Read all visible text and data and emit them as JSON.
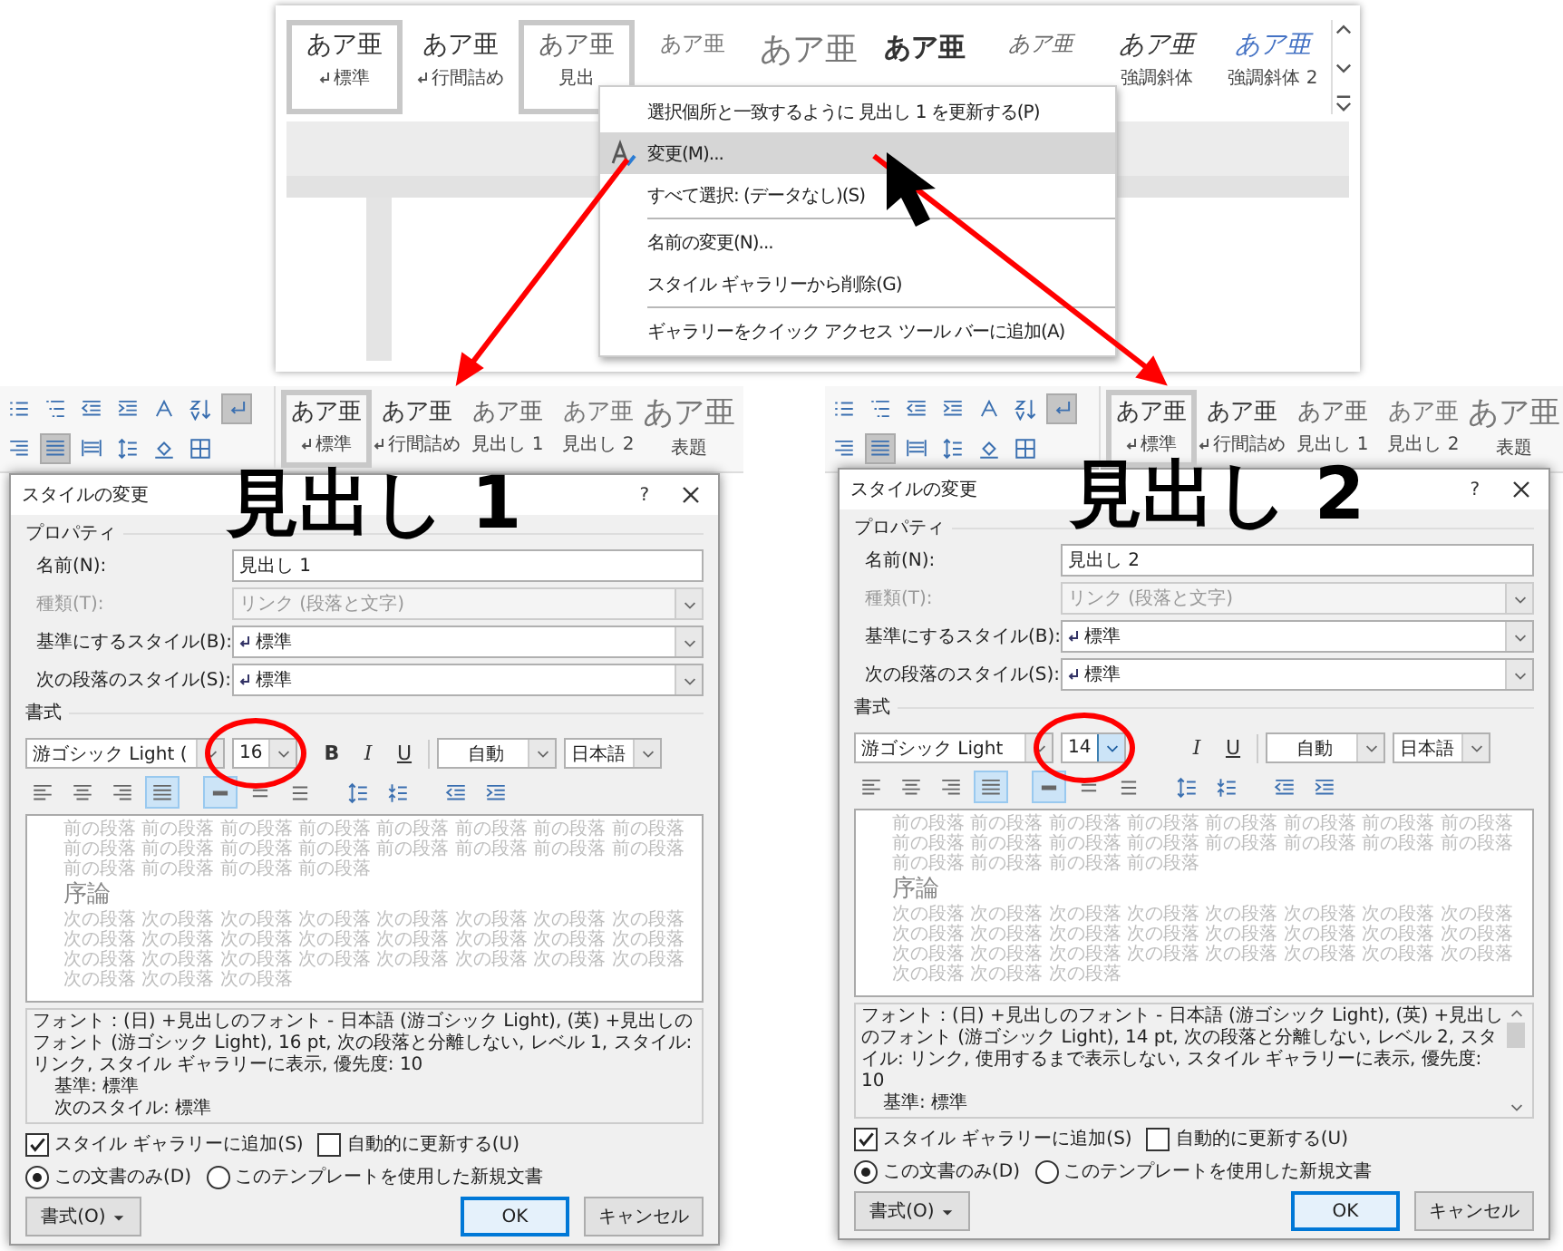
{
  "top_window": {
    "gallery": [
      {
        "sample": "あア亜",
        "label": "標準",
        "linked": true,
        "selected": true,
        "kind": "normal"
      },
      {
        "sample": "あア亜",
        "label": "行間詰め",
        "linked": true,
        "selected": false,
        "kind": "normal"
      },
      {
        "sample": "あア亜",
        "label": "見出",
        "selected": true,
        "kind": "light"
      },
      {
        "sample": "あア亜",
        "selected": false,
        "kind": "light-small"
      },
      {
        "sample": "あア亜",
        "selected": false,
        "kind": "large"
      },
      {
        "sample": "あア亜",
        "selected": false,
        "kind": "bold"
      },
      {
        "sample": "あア亜",
        "selected": false,
        "kind": "italic-light"
      },
      {
        "sample": "あア亜",
        "label": "強調斜体",
        "selected": false,
        "kind": "italic"
      },
      {
        "sample": "あア亜",
        "label": "強調斜体 2",
        "selected": false,
        "kind": "accent"
      }
    ],
    "context_menu": [
      {
        "text": "選択個所と一致するように 見出し 1 を更新する(P)",
        "highlighted": false,
        "has_icon": false,
        "separator_below": false
      },
      {
        "text": "変更(M)...",
        "highlighted": true,
        "has_icon": true,
        "separator_below": false
      },
      {
        "text": "すべて選択: (データなし)(S)",
        "highlighted": false,
        "has_icon": false,
        "separator_below": true
      },
      {
        "text": "名前の変更(N)...",
        "highlighted": false,
        "has_icon": false,
        "separator_below": false
      },
      {
        "text": "スタイル ギャラリーから削除(G)",
        "highlighted": false,
        "has_icon": false,
        "separator_below": true
      },
      {
        "text": "ギャラリーをクイック アクセス ツール バーに追加(A)",
        "highlighted": false,
        "has_icon": false,
        "separator_below": false
      }
    ]
  },
  "panels": [
    {
      "caption": "見出し 1",
      "ribbon": {
        "row1": [
          {
            "kind": "bullets",
            "selected": false
          },
          {
            "kind": "multilevel",
            "selected": false
          },
          {
            "kind": "indent-decrease",
            "selected": false
          },
          {
            "kind": "indent-increase",
            "selected": false
          },
          {
            "kind": "asian-layout",
            "selected": false
          },
          {
            "kind": "sort",
            "selected": false
          },
          {
            "kind": "show-marks",
            "selected": true
          }
        ],
        "row2": [
          {
            "kind": "align-right",
            "selected": false
          },
          {
            "kind": "justify",
            "selected": true
          },
          {
            "kind": "distributed",
            "selected": false
          },
          {
            "kind": "line-spacing",
            "selected": false
          },
          {
            "kind": "shading",
            "selected": false
          },
          {
            "kind": "borders",
            "selected": false
          }
        ],
        "gallery": [
          {
            "sample": "あア亜",
            "label": "標準",
            "linked": true,
            "selected": true,
            "kind": "normal"
          },
          {
            "sample": "あア亜",
            "label": "行間詰め",
            "linked": true,
            "selected": false,
            "kind": "normal"
          },
          {
            "sample": "あア亜",
            "label": "見出し 1",
            "selected": false,
            "kind": "light"
          },
          {
            "sample": "あア亜",
            "label": "見出し 2",
            "selected": false,
            "kind": "light-small"
          },
          {
            "sample": "あア亜",
            "label": "表題",
            "selected": false,
            "kind": "large"
          }
        ]
      },
      "dialog": {
        "title": "スタイルの変更",
        "help": "?",
        "properties_heading": "プロパティ",
        "fields": [
          {
            "label": "名前(N):",
            "value": "見出し 1",
            "kind": "text",
            "disabled": false
          },
          {
            "label": "種類(T):",
            "value": "リンク (段落と文字)",
            "kind": "select",
            "disabled": true
          },
          {
            "label": "基準にするスタイル(B):",
            "value": "標準",
            "kind": "select",
            "linked": true,
            "disabled": false
          },
          {
            "label": "次の段落のスタイル(S):",
            "value": "標準",
            "kind": "select",
            "linked": true,
            "disabled": false
          }
        ],
        "format_heading": "書式",
        "font": "游ゴシック Light (",
        "size": "16",
        "size_focused": false,
        "format_buttons": [
          {
            "kind": "bold",
            "text": "B"
          },
          {
            "kind": "italic",
            "text": "I"
          },
          {
            "kind": "underline",
            "text": "U"
          }
        ],
        "font_color": "自動",
        "language": "日本語",
        "align_tools": [
          {
            "kind": "align-left",
            "selected": false
          },
          {
            "kind": "align-center",
            "selected": false
          },
          {
            "kind": "align-right",
            "selected": false
          },
          {
            "kind": "justify",
            "selected": true
          },
          {
            "kind": "single",
            "selected": true
          },
          {
            "kind": "one-half",
            "selected": false
          },
          {
            "kind": "double",
            "selected": false
          },
          {
            "kind": "spacing-increase",
            "selected": false
          },
          {
            "kind": "spacing-decrease",
            "selected": false
          },
          {
            "kind": "indent-decrease",
            "selected": false
          },
          {
            "kind": "indent-increase",
            "selected": false
          }
        ],
        "preview": {
          "previous": [
            "前の段落 前の段落 前の段落 前の段落 前の段落 前の段落 前の段落 前の段落",
            "前の段落 前の段落 前の段落 前の段落 前の段落 前の段落 前の段落 前の段落",
            "前の段落 前の段落 前の段落 前の段落"
          ],
          "sample": "序論",
          "next": [
            "次の段落 次の段落 次の段落 次の段落 次の段落 次の段落 次の段落 次の段落",
            "次の段落 次の段落 次の段落 次の段落 次の段落 次の段落 次の段落 次の段落",
            "次の段落 次の段落 次の段落 次の段落 次の段落 次の段落 次の段落 次の段落",
            "次の段落 次の段落 次の段落"
          ]
        },
        "description": [
          "フォント：(日) +見出しのフォント - 日本語 (游ゴシック Light), (英) +見出しのフォント (游ゴシック Light), 16 pt, 次の段落と分離しない, レベル 1, スタイル: リンク, スタイル ギャラリーに表示, 優先度: 10",
          "基準: 標準",
          "次のスタイル: 標準"
        ],
        "description_scrollbar": false,
        "checkboxes": [
          {
            "label": "スタイル ギャラリーに追加(S)",
            "checked": true
          },
          {
            "label": "自動的に更新する(U)",
            "checked": false
          }
        ],
        "radios": [
          {
            "label": "この文書のみ(D)",
            "selected": true
          },
          {
            "label": "このテンプレートを使用した新規文書",
            "selected": false
          }
        ],
        "buttons": [
          {
            "label": "書式(O)",
            "kind": "format"
          },
          {
            "label": "OK",
            "kind": "ok"
          },
          {
            "label": "キャンセル",
            "kind": "cancel"
          }
        ]
      }
    },
    {
      "caption": "見出し 2",
      "ribbon": {
        "row1": [
          {
            "kind": "bullets",
            "selected": false
          },
          {
            "kind": "multilevel",
            "selected": false
          },
          {
            "kind": "indent-decrease",
            "selected": false
          },
          {
            "kind": "indent-increase",
            "selected": false
          },
          {
            "kind": "asian-layout",
            "selected": false
          },
          {
            "kind": "sort",
            "selected": false
          },
          {
            "kind": "show-marks",
            "selected": true
          }
        ],
        "row2": [
          {
            "kind": "align-right",
            "selected": false
          },
          {
            "kind": "justify",
            "selected": true
          },
          {
            "kind": "distributed",
            "selected": false
          },
          {
            "kind": "line-spacing",
            "selected": false
          },
          {
            "kind": "shading",
            "selected": false
          },
          {
            "kind": "borders",
            "selected": false
          }
        ],
        "gallery": [
          {
            "sample": "あア亜",
            "label": "標準",
            "linked": true,
            "selected": true,
            "kind": "normal"
          },
          {
            "sample": "あア亜",
            "label": "行間詰め",
            "linked": true,
            "selected": false,
            "kind": "normal"
          },
          {
            "sample": "あア亜",
            "label": "見出し 1",
            "selected": false,
            "kind": "light"
          },
          {
            "sample": "あア亜",
            "label": "見出し 2",
            "selected": false,
            "kind": "light-small"
          },
          {
            "sample": "あア亜",
            "label": "表題",
            "selected": false,
            "kind": "large"
          }
        ]
      },
      "dialog": {
        "title": "スタイルの変更",
        "help": "?",
        "properties_heading": "プロパティ",
        "fields": [
          {
            "label": "名前(N):",
            "value": "見出し 2",
            "kind": "text",
            "disabled": false
          },
          {
            "label": "種類(T):",
            "value": "リンク (段落と文字)",
            "kind": "select",
            "disabled": true
          },
          {
            "label": "基準にするスタイル(B):",
            "value": "標準",
            "kind": "select",
            "linked": true,
            "disabled": false
          },
          {
            "label": "次の段落のスタイル(S):",
            "value": "標準",
            "kind": "select",
            "linked": true,
            "disabled": false
          }
        ],
        "format_heading": "書式",
        "font": "游ゴシック Light",
        "size": "14",
        "size_focused": true,
        "format_buttons": [
          {
            "kind": "italic",
            "text": "I"
          },
          {
            "kind": "underline",
            "text": "U"
          }
        ],
        "font_color": "自動",
        "language": "日本語",
        "align_tools": [
          {
            "kind": "align-left",
            "selected": false
          },
          {
            "kind": "align-center",
            "selected": false
          },
          {
            "kind": "align-right",
            "selected": false
          },
          {
            "kind": "justify",
            "selected": true
          },
          {
            "kind": "single",
            "selected": true
          },
          {
            "kind": "one-half",
            "selected": false
          },
          {
            "kind": "double",
            "selected": false
          },
          {
            "kind": "spacing-increase",
            "selected": false
          },
          {
            "kind": "spacing-decrease",
            "selected": false
          },
          {
            "kind": "indent-decrease",
            "selected": false
          },
          {
            "kind": "indent-increase",
            "selected": false
          }
        ],
        "preview": {
          "previous": [
            "前の段落 前の段落 前の段落 前の段落 前の段落 前の段落 前の段落 前の段落",
            "前の段落 前の段落 前の段落 前の段落 前の段落 前の段落 前の段落 前の段落",
            "前の段落 前の段落 前の段落 前の段落"
          ],
          "sample": "序論",
          "next": [
            "次の段落 次の段落 次の段落 次の段落 次の段落 次の段落 次の段落 次の段落",
            "次の段落 次の段落 次の段落 次の段落 次の段落 次の段落 次の段落 次の段落",
            "次の段落 次の段落 次の段落 次の段落 次の段落 次の段落 次の段落 次の段落",
            "次の段落 次の段落 次の段落"
          ]
        },
        "description": [
          "フォント：(日) +見出しのフォント - 日本語 (游ゴシック Light), (英) +見出しのフォント (游ゴシック Light), 14 pt, 次の段落と分離しない, レベル 2, スタイル: リンク, 使用するまで表示しない, スタイル ギャラリーに表示, 優先度: 10",
          "基準: 標準"
        ],
        "description_scrollbar": true,
        "checkboxes": [
          {
            "label": "スタイル ギャラリーに追加(S)",
            "checked": true
          },
          {
            "label": "自動的に更新する(U)",
            "checked": false
          }
        ],
        "radios": [
          {
            "label": "この文書のみ(D)",
            "selected": true
          },
          {
            "label": "このテンプレートを使用した新規文書",
            "selected": false
          }
        ],
        "buttons": [
          {
            "label": "書式(O)",
            "kind": "format"
          },
          {
            "label": "OK",
            "kind": "ok"
          },
          {
            "label": "キャンセル",
            "kind": "cancel"
          }
        ]
      }
    }
  ]
}
